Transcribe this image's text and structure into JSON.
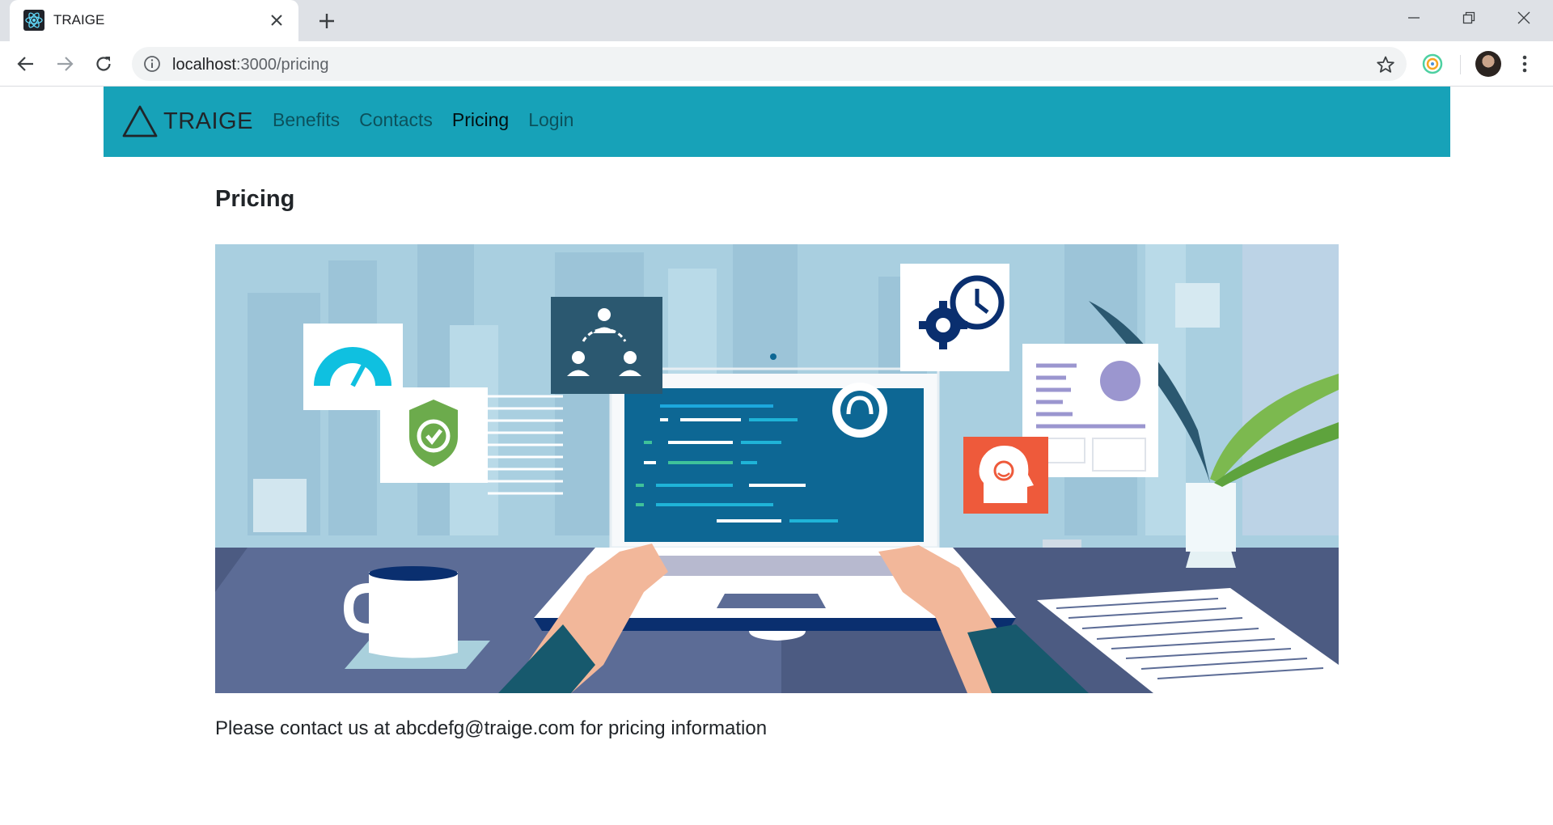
{
  "browser": {
    "tab_title": "TRAIGE",
    "url_host": "localhost",
    "url_path": ":3000/pricing"
  },
  "navbar": {
    "brand": "TRAIGE",
    "links": [
      {
        "label": "Benefits"
      },
      {
        "label": "Contacts"
      },
      {
        "label": "Pricing"
      },
      {
        "label": "Login"
      }
    ],
    "background": "#17a2b8"
  },
  "page": {
    "title": "Pricing",
    "contact_text": "Please contact us at abcdefg@traige.com for pricing information"
  },
  "icons": [
    "react-icon",
    "close-icon",
    "plus-icon",
    "back-icon",
    "forward-icon",
    "reload-icon",
    "info-icon",
    "star-icon",
    "extension-icon",
    "avatar",
    "menu-icon",
    "triangle-logo"
  ]
}
